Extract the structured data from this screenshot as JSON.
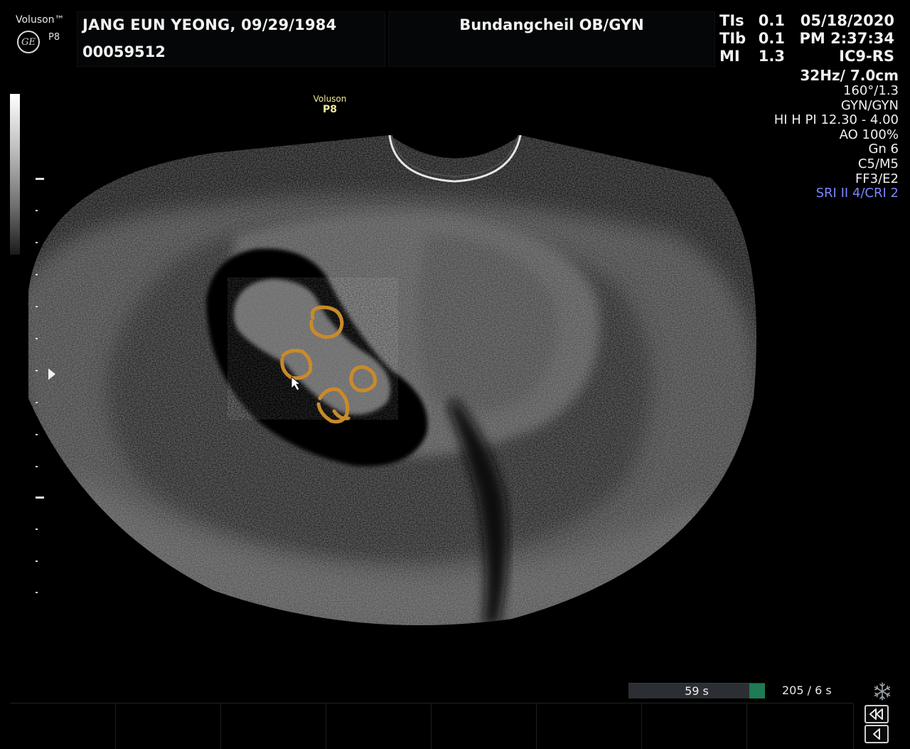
{
  "header": {
    "brand": "Voluson™",
    "model_small": "P8",
    "patient_name_dob": "JANG EUN YEONG,   09/29/1984",
    "patient_id": "00059512",
    "institution": "Bundangcheil OB/GYN",
    "safety": [
      {
        "label": "TIs",
        "value": "0.1"
      },
      {
        "label": "TIb",
        "value": "0.1"
      },
      {
        "label": "MI",
        "value": "1.3"
      }
    ],
    "date": "05/18/2020",
    "time": "PM 2:37:34",
    "probe": "IC9-RS"
  },
  "params": {
    "frame_depth": "32Hz/ 7.0cm",
    "angle": "160°/1.3",
    "application": "GYN/GYN",
    "harmonic": "HI H PI 12.30 - 4.00",
    "acoustic_output": "AO 100%",
    "gain": "Gn   6",
    "map": "C5/M5",
    "frame_filter": "FF3/E2",
    "sri": "SRI II 4/CRI 2"
  },
  "probe_label": {
    "line1": "Voluson",
    "line2": "P8"
  },
  "cine": {
    "time": "59 s",
    "frames": "205 / 6 s",
    "progress": 0.885
  },
  "icons": {
    "ge_logo": "ge-logo-icon",
    "freeze": "snowflake-icon",
    "rewind": "rewind-icon",
    "prev": "prev-frame-icon",
    "cursor": "mouse-pointer-icon"
  },
  "colors": {
    "annotation": "#c98a2b",
    "sri_text": "#7a86ff",
    "probe_label": "#f3eb9a",
    "cine_fill": "#1f7a55"
  }
}
